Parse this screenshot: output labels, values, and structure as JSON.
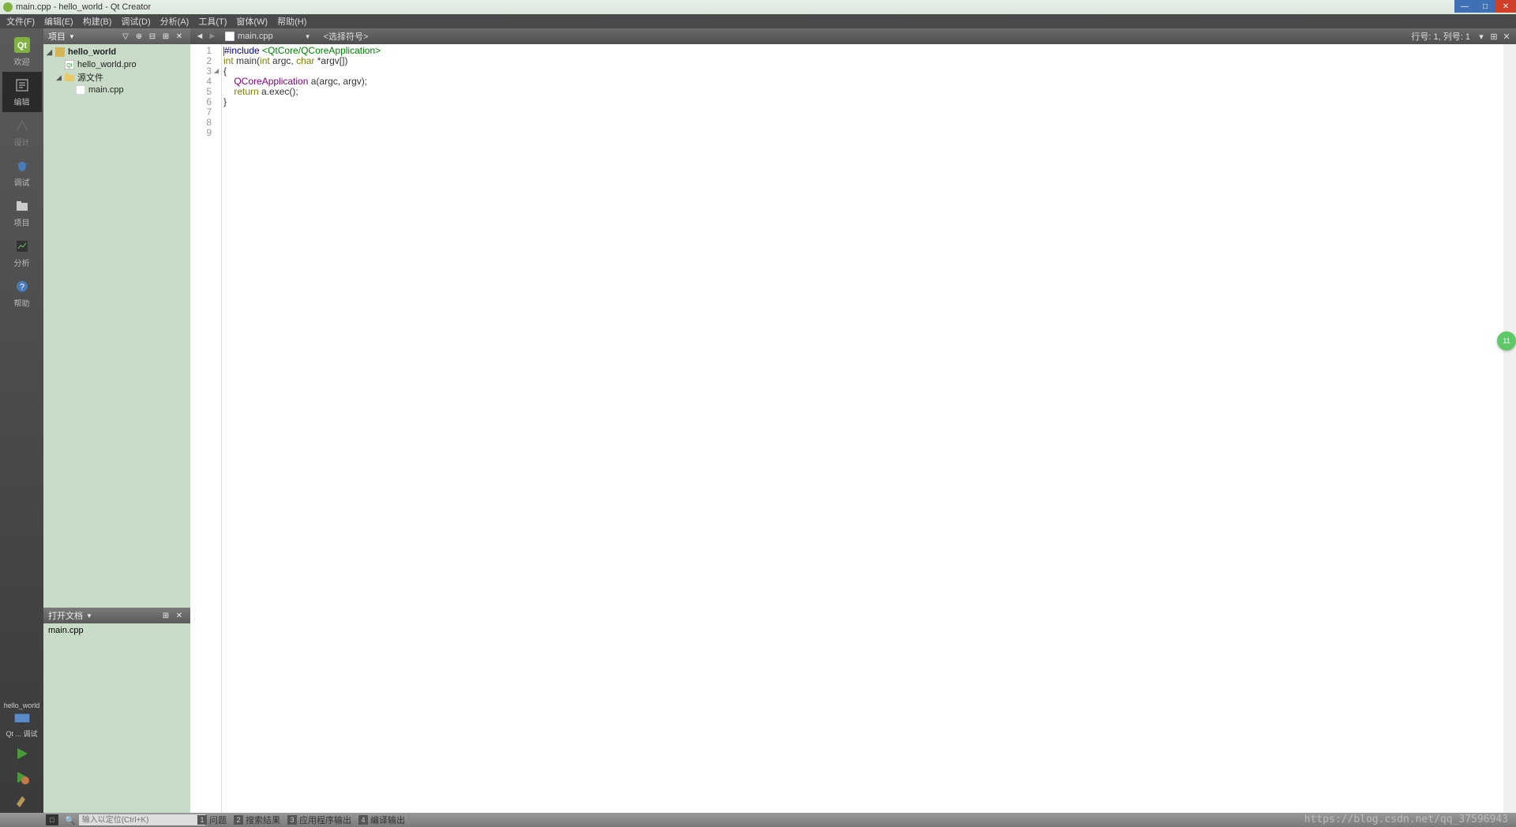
{
  "title": "main.cpp - hello_world - Qt Creator",
  "menu": [
    "文件(F)",
    "编辑(E)",
    "构建(B)",
    "调试(D)",
    "分析(A)",
    "工具(T)",
    "窗体(W)",
    "帮助(H)"
  ],
  "modes": [
    {
      "label": "欢迎",
      "icon": "qt"
    },
    {
      "label": "编辑",
      "icon": "edit",
      "active": true
    },
    {
      "label": "设计",
      "icon": "design"
    },
    {
      "label": "调试",
      "icon": "debug"
    },
    {
      "label": "项目",
      "icon": "project"
    },
    {
      "label": "分析",
      "icon": "analyze"
    },
    {
      "label": "帮助",
      "icon": "help"
    }
  ],
  "kit": {
    "project": "hello_world",
    "config": "Qt ... 调试"
  },
  "project_panel": {
    "title": "项目",
    "tree": {
      "root": "hello_world",
      "pro": "hello_world.pro",
      "sources_label": "源文件",
      "file": "main.cpp"
    }
  },
  "open_docs": {
    "title": "打开文档",
    "items": [
      "main.cpp"
    ]
  },
  "editor": {
    "file": "main.cpp",
    "symbol": "<选择符号>",
    "position": "行号: 1, 列号: 1",
    "lines": {
      "l1_a": "#include ",
      "l1_b": "<QtCore/QCoreApplication>",
      "l2": "",
      "l3_a": "int",
      "l3_b": " main(",
      "l3_c": "int",
      "l3_d": " argc, ",
      "l3_e": "char",
      "l3_f": " *argv[])",
      "l4": "{",
      "l5_a": "    ",
      "l5_b": "QCoreApplication",
      "l5_c": " a(argc, argv);",
      "l6": "",
      "l7_a": "    ",
      "l7_b": "return",
      "l7_c": " a.exec();",
      "l8": "}",
      "l9": ""
    },
    "linenums": [
      "1",
      "2",
      "3",
      "4",
      "5",
      "6",
      "7",
      "8",
      "9"
    ]
  },
  "status": {
    "search_placeholder": "输入以定位(Ctrl+K)",
    "tabs": [
      {
        "n": "1",
        "label": "问题"
      },
      {
        "n": "2",
        "label": "搜索结果"
      },
      {
        "n": "3",
        "label": "应用程序输出"
      },
      {
        "n": "4",
        "label": "编译输出"
      }
    ]
  },
  "watermark": "https://blog.csdn.net/qq_37596943",
  "badge": "11"
}
